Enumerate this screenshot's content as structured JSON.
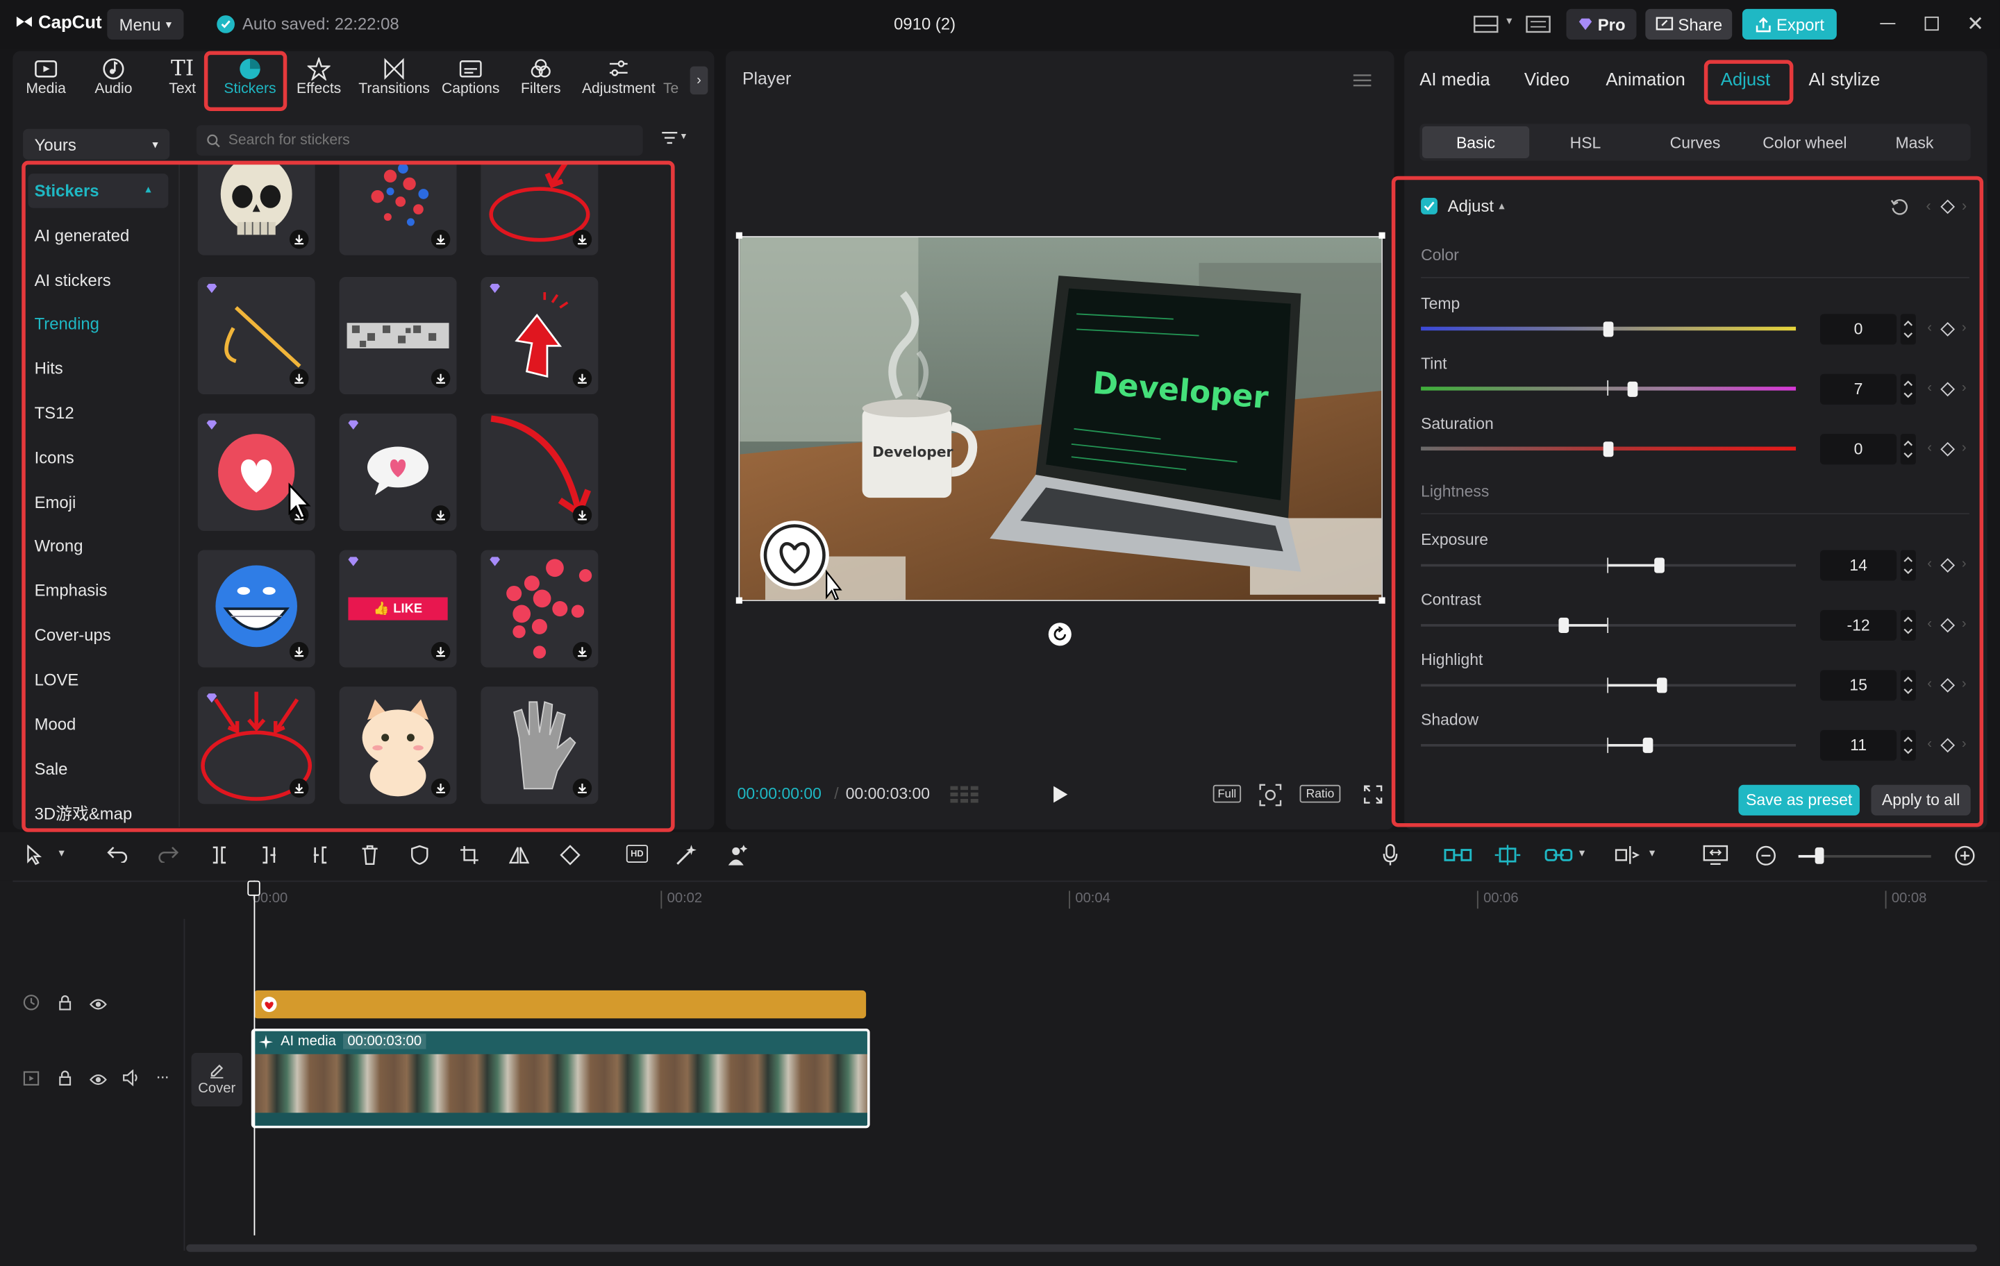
{
  "app": {
    "name": "CapCut",
    "menu_label": "Menu",
    "autosave": "Auto saved: 22:22:08",
    "project_title": "0910 (2)",
    "pro_label": "Pro",
    "share_label": "Share",
    "export_label": "Export"
  },
  "toolbar": {
    "items": [
      {
        "label": "Media",
        "icon": "media-icon"
      },
      {
        "label": "Audio",
        "icon": "audio-icon"
      },
      {
        "label": "Text",
        "icon": "text-icon"
      },
      {
        "label": "Stickers",
        "icon": "stickers-icon",
        "active": true
      },
      {
        "label": "Effects",
        "icon": "effects-icon"
      },
      {
        "label": "Transitions",
        "icon": "transitions-icon"
      },
      {
        "label": "Captions",
        "icon": "captions-icon"
      },
      {
        "label": "Filters",
        "icon": "filters-icon"
      },
      {
        "label": "Adjustment",
        "icon": "adjustment-icon"
      },
      {
        "label": "Te",
        "icon": "template-icon"
      }
    ]
  },
  "stickers": {
    "source_select": "Yours",
    "search_placeholder": "Search for stickers",
    "categories": [
      "Stickers",
      "AI generated",
      "AI stickers",
      "Trending",
      "Hits",
      "TS12",
      "Icons",
      "Emoji",
      "Wrong",
      "Emphasis",
      "Cover-ups",
      "LOVE",
      "Mood",
      "Sale",
      "3D游戏&map"
    ],
    "active_category": "Stickers",
    "highlighted_category": "Trending",
    "tiles": [
      "skull",
      "heart-emojis",
      "red-circle-arrow",
      "golden-slash",
      "pixel-censor-bar",
      "red-arrow-up",
      "heart-circle",
      "speech-bubble-heart",
      "curved-red-arrow",
      "laughing-emoji",
      "like-badge",
      "floating-hearts",
      "red-arrows-circle",
      "kawaii-cat",
      "glitter-hand"
    ],
    "like_text": "LIKE"
  },
  "player": {
    "title": "Player",
    "current_time": "00:00:00:00",
    "total_time": "00:00:03:00",
    "mug_text": "Developer",
    "screen_text": "Developer",
    "btn_full": "Full",
    "btn_ratio": "Ratio"
  },
  "inspector": {
    "tabs": [
      "AI media",
      "Video",
      "Animation",
      "Adjust",
      "AI stylize"
    ],
    "active_tab": "Adjust",
    "subtabs": [
      "Basic",
      "HSL",
      "Curves",
      "Color wheel",
      "Mask"
    ],
    "active_subtab": "Basic",
    "section_title": "Adjust",
    "group_color": "Color",
    "group_lightness": "Lightness",
    "params": [
      {
        "label": "Temp",
        "value": "0"
      },
      {
        "label": "Tint",
        "value": "7"
      },
      {
        "label": "Saturation",
        "value": "0"
      },
      {
        "label": "Exposure",
        "value": "14"
      },
      {
        "label": "Contrast",
        "value": "-12"
      },
      {
        "label": "Highlight",
        "value": "15"
      },
      {
        "label": "Shadow",
        "value": "11"
      }
    ],
    "save_preset": "Save as preset",
    "apply_all": "Apply to all"
  },
  "timeline": {
    "ticks": [
      "00:00",
      "00:02",
      "00:04",
      "00:06",
      "00:08"
    ],
    "clip_label": "AI media",
    "clip_duration": "00:00:03:00",
    "cover_label": "Cover"
  },
  "colors": {
    "accent": "#1fb8c4",
    "highlight": "#e5393c",
    "sticker_track": "#d59a2c",
    "video_track": "#1f5f63"
  }
}
